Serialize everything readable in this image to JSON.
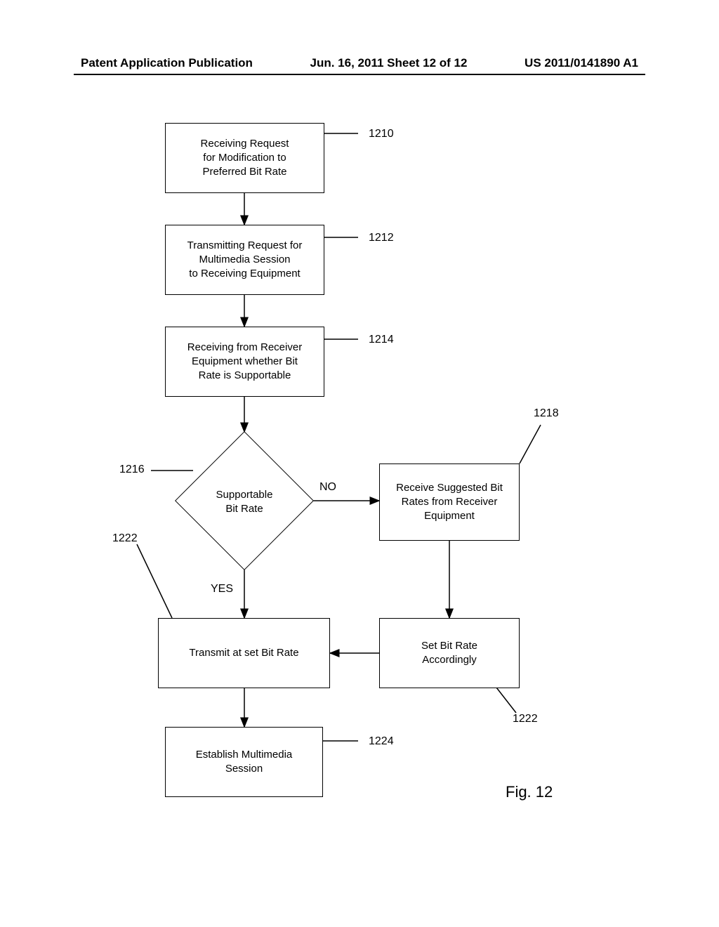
{
  "header": {
    "left": "Patent Application Publication",
    "center": "Jun. 16, 2011  Sheet 12 of 12",
    "right": "US 2011/0141890 A1"
  },
  "boxes": {
    "b1210": "Receiving Request\nfor Modification to\nPreferred Bit Rate",
    "b1212": "Transmitting Request for\nMultimedia Session\nto Receiving Equipment",
    "b1214": "Receiving from Receiver\nEquipment whether Bit\nRate is Supportable",
    "d1216": "Supportable\nBit Rate",
    "b1218": "Receive Suggested Bit\nRates from Receiver\nEquipment",
    "b1222a": "Transmit at set Bit Rate",
    "b1222b": "Set Bit Rate\nAccordingly",
    "b1224": "Establish Multimedia\nSession"
  },
  "refs": {
    "r1210": "1210",
    "r1212": "1212",
    "r1214": "1214",
    "r1216": "1216",
    "r1218": "1218",
    "r1222a": "1222",
    "r1222b": "1222",
    "r1224": "1224"
  },
  "edges": {
    "no": "NO",
    "yes": "YES"
  },
  "figure": "Fig. 12"
}
